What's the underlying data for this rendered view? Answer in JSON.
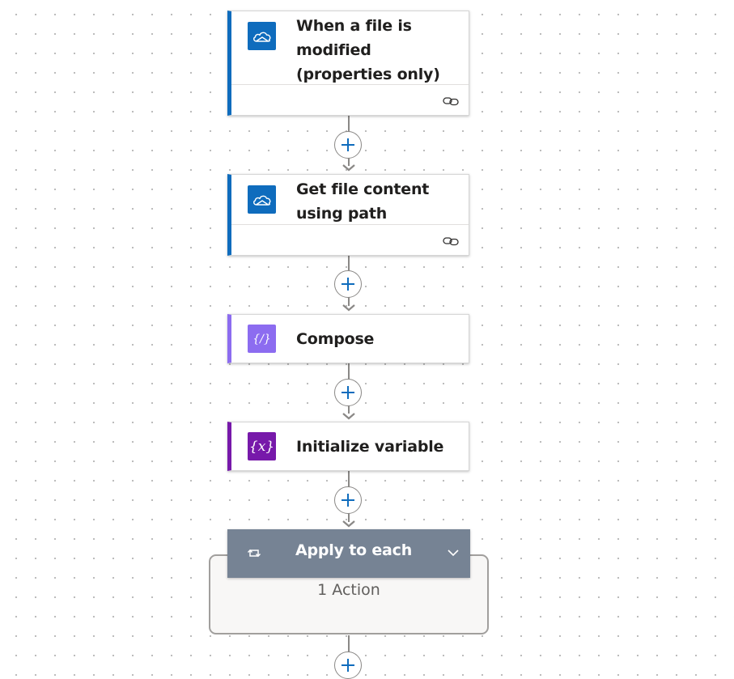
{
  "steps": [
    {
      "title": "When a file is modified (properties only)",
      "icon": "onedrive-cloud-icon",
      "accent": "#0f6cbd",
      "icon_bg": "#0f6cbd",
      "has_footer": true
    },
    {
      "title": "Get file content using path",
      "icon": "onedrive-cloud-icon",
      "accent": "#0f6cbd",
      "icon_bg": "#0f6cbd",
      "has_footer": true
    },
    {
      "title": "Compose",
      "icon": "compose-braces-icon",
      "accent": "#8c6cf0",
      "icon_bg": "#8c6cf0",
      "has_footer": false
    },
    {
      "title": "Initialize variable",
      "icon": "variable-x-icon",
      "accent": "#7719aa",
      "icon_bg": "#7719aa",
      "has_footer": false
    }
  ],
  "apply_to_each": {
    "title": "Apply to each",
    "icon": "loop-icon",
    "chevron": "chevron-down-icon",
    "action_count": "1 Action",
    "header_bg": "#768394"
  },
  "colors": {
    "wire": "#8a8886",
    "add_button_plus": "#0f6cbd",
    "canvas_dots": "#b8b8b8"
  }
}
